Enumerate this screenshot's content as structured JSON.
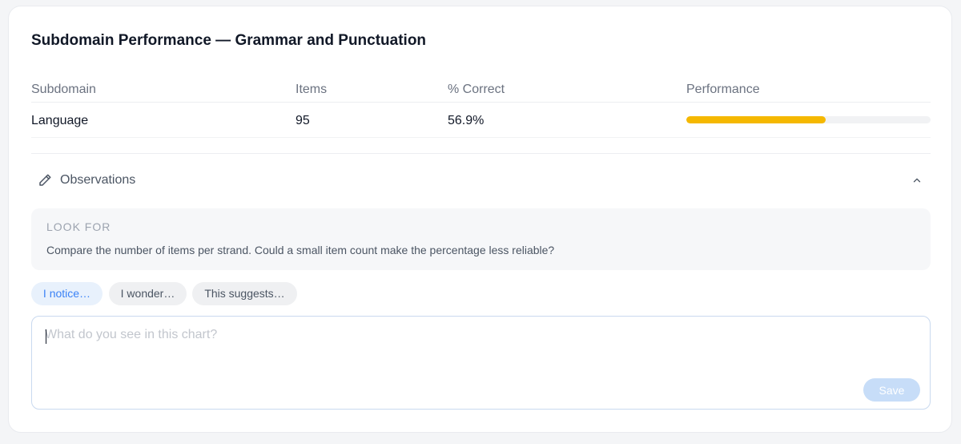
{
  "card": {
    "title": "Subdomain Performance — Grammar and Punctuation"
  },
  "table": {
    "headers": [
      "Subdomain",
      "Items",
      "% Correct",
      "Performance"
    ],
    "rows": [
      {
        "subdomain": "Language",
        "items": "95",
        "percent_correct": "56.9%",
        "performance_fraction": 0.569
      }
    ]
  },
  "observations": {
    "label": "Observations",
    "icon": "pencil-icon",
    "collapse_icon": "chevron-up-icon",
    "look_for": {
      "title": "LOOK FOR",
      "text": "Compare the number of items per strand. Could a small item count make the percentage less reliable?"
    },
    "chips": [
      {
        "label": "I notice…",
        "active": true
      },
      {
        "label": "I wonder…",
        "active": false
      },
      {
        "label": "This suggests…",
        "active": false
      }
    ],
    "input": {
      "value": "",
      "placeholder": "What do you see in this chart?"
    },
    "save_label": "Save"
  },
  "colors": {
    "accent": "#3b82f6",
    "performance_bar": "#f5b800",
    "bar_track": "#f1f2f4",
    "save_disabled": "#c7ddf8"
  }
}
